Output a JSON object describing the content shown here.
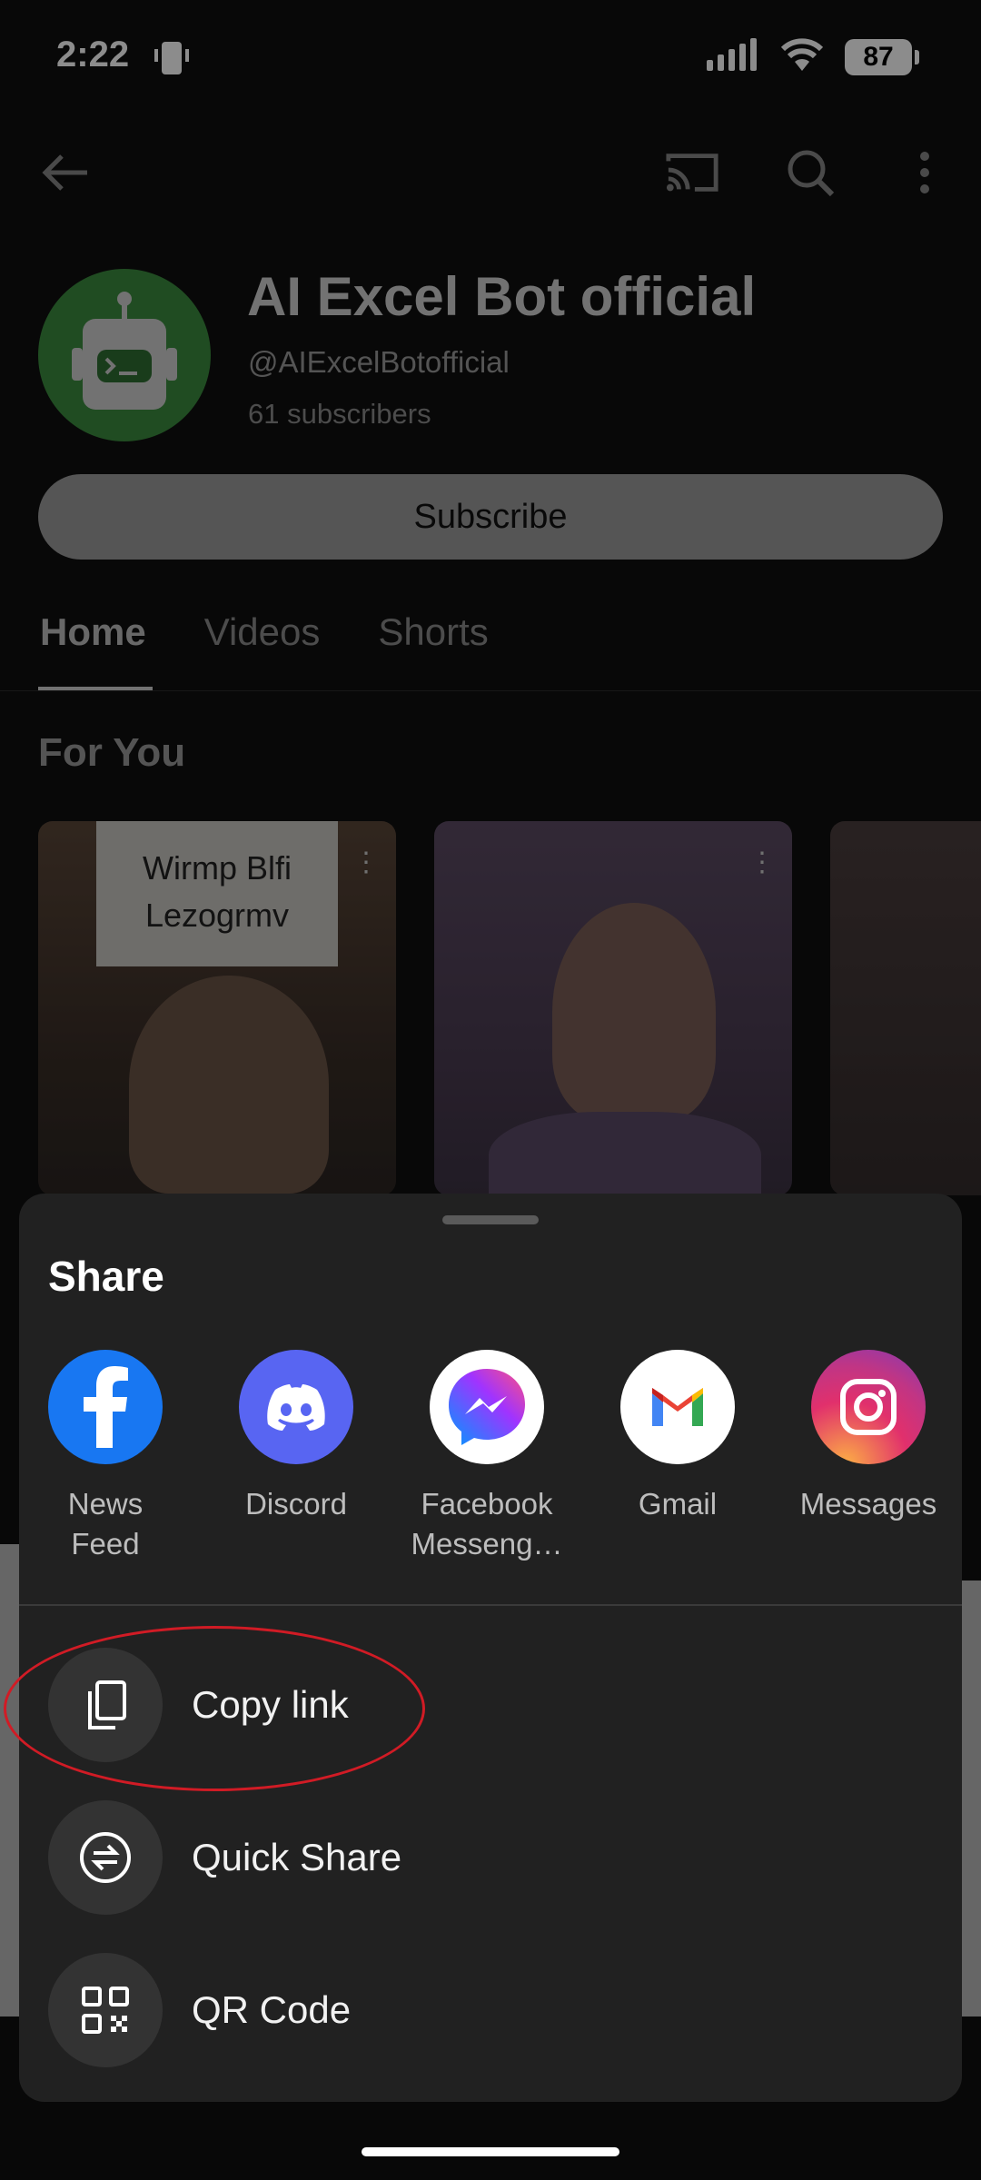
{
  "status_bar": {
    "time": "2:22",
    "battery": "87"
  },
  "channel": {
    "name": "AI Excel Bot official",
    "handle": "@AIExcelBotofficial",
    "subscribers": "61 subscribers",
    "subscribe_label": "Subscribe"
  },
  "tabs": [
    "Home",
    "Videos",
    "Shorts"
  ],
  "section": {
    "title": "For You"
  },
  "thumbnail_overlay_text": "Wirmp Blfi\nLezogrmv",
  "share_sheet": {
    "title": "Share",
    "apps": [
      {
        "label": "News Feed",
        "color": "#1877F2",
        "icon": "facebook-icon"
      },
      {
        "label": "Discord",
        "color": "#5865F2",
        "icon": "discord-icon"
      },
      {
        "label": "Facebook Messeng…",
        "color": "#ffffff",
        "icon": "messenger-icon"
      },
      {
        "label": "Gmail",
        "color": "#ffffff",
        "icon": "gmail-icon"
      },
      {
        "label": "Messages",
        "color": "#E1306C",
        "icon": "instagram-icon"
      }
    ],
    "actions": [
      {
        "label": "Copy link",
        "icon": "copy-icon"
      },
      {
        "label": "Quick Share",
        "icon": "quick-share-icon"
      },
      {
        "label": "QR Code",
        "icon": "qr-code-icon"
      }
    ]
  },
  "colors": {
    "highlight": "#d11b25",
    "sheet_bg": "#212121"
  }
}
